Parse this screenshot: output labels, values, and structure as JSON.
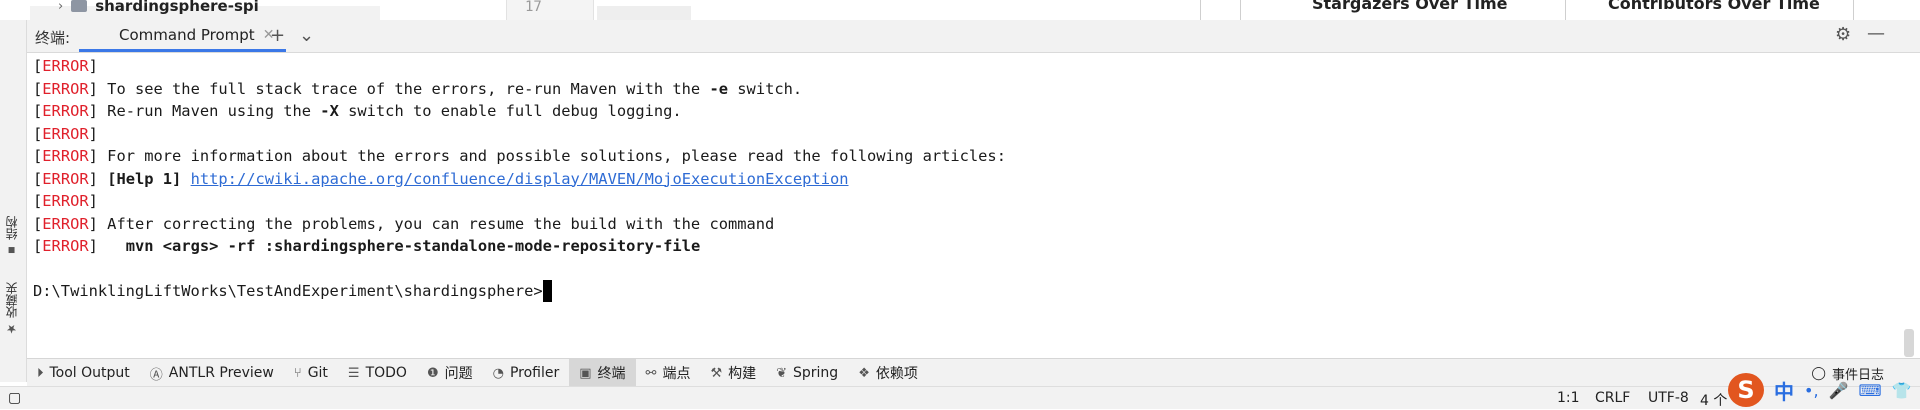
{
  "editor_strip": {
    "project_item": "shardingsphere-spi",
    "line_number": "17",
    "table_headers": [
      "Stargazers Over Time",
      "Contributors Over Time"
    ]
  },
  "left_strip": {
    "structure_label": "结构",
    "favorites_label": "收藏夹"
  },
  "terminal": {
    "panel_label": "终端:",
    "tab_title": "Command Prompt",
    "add_icon": "plus-icon",
    "dropdown_icon": "chevron-down-icon",
    "settings_icon": "gear-icon",
    "minimize_icon": "minimize-icon",
    "lines": [
      {
        "tag": "ERROR",
        "text": ""
      },
      {
        "tag": "ERROR",
        "pre": " To see the full stack trace of the errors, re-run Maven with the ",
        "bold": "-e",
        "post": " switch."
      },
      {
        "tag": "ERROR",
        "pre": " Re-run Maven using the ",
        "bold": "-X",
        "post": " switch to enable full debug logging."
      },
      {
        "tag": "ERROR",
        "text": ""
      },
      {
        "tag": "ERROR",
        "pre": " For more information about the errors and possible solutions, please read the following articles:"
      },
      {
        "tag": "ERROR",
        "pre": " ",
        "bold": "[Help 1]",
        "post": " ",
        "link": "http://cwiki.apache.org/confluence/display/MAVEN/MojoExecutionException"
      },
      {
        "tag": "ERROR",
        "text": ""
      },
      {
        "tag": "ERROR",
        "pre": " After correcting the problems, you can resume the build with the command"
      },
      {
        "tag": "ERROR",
        "pre": "   ",
        "bold": "mvn <args> -rf :shardingsphere-standalone-mode-repository-file"
      }
    ],
    "prompt": "D:\\TwinklingLiftWorks\\TestAndExperiment\\shardingsphere>"
  },
  "bottom_tools": [
    {
      "icon": "tool-output-icon",
      "label": "Tool Output"
    },
    {
      "icon": "antlr-icon",
      "label": "ANTLR Preview"
    },
    {
      "icon": "git-branch-icon",
      "label": "Git"
    },
    {
      "icon": "list-icon",
      "label": "TODO"
    },
    {
      "icon": "warning-icon",
      "label": "问题"
    },
    {
      "icon": "profiler-icon",
      "label": "Profiler"
    },
    {
      "icon": "terminal-icon",
      "label": "终端",
      "active": true
    },
    {
      "icon": "endpoints-icon",
      "label": "端点"
    },
    {
      "icon": "hammer-icon",
      "label": "构建"
    },
    {
      "icon": "spring-leaf-icon",
      "label": "Spring"
    },
    {
      "icon": "dependencies-icon",
      "label": "依赖项"
    }
  ],
  "event_log": "事件日志",
  "status_bar": {
    "position": "1:1",
    "line_ending": "CRLF",
    "encoding": "UTF-8",
    "indent": "4 个",
    "ime_logo": "S",
    "ime_mode": "中"
  },
  "colors": {
    "error": "#e0202b",
    "link": "#2e6bd4",
    "active_tab_underline": "#3b78e7"
  }
}
